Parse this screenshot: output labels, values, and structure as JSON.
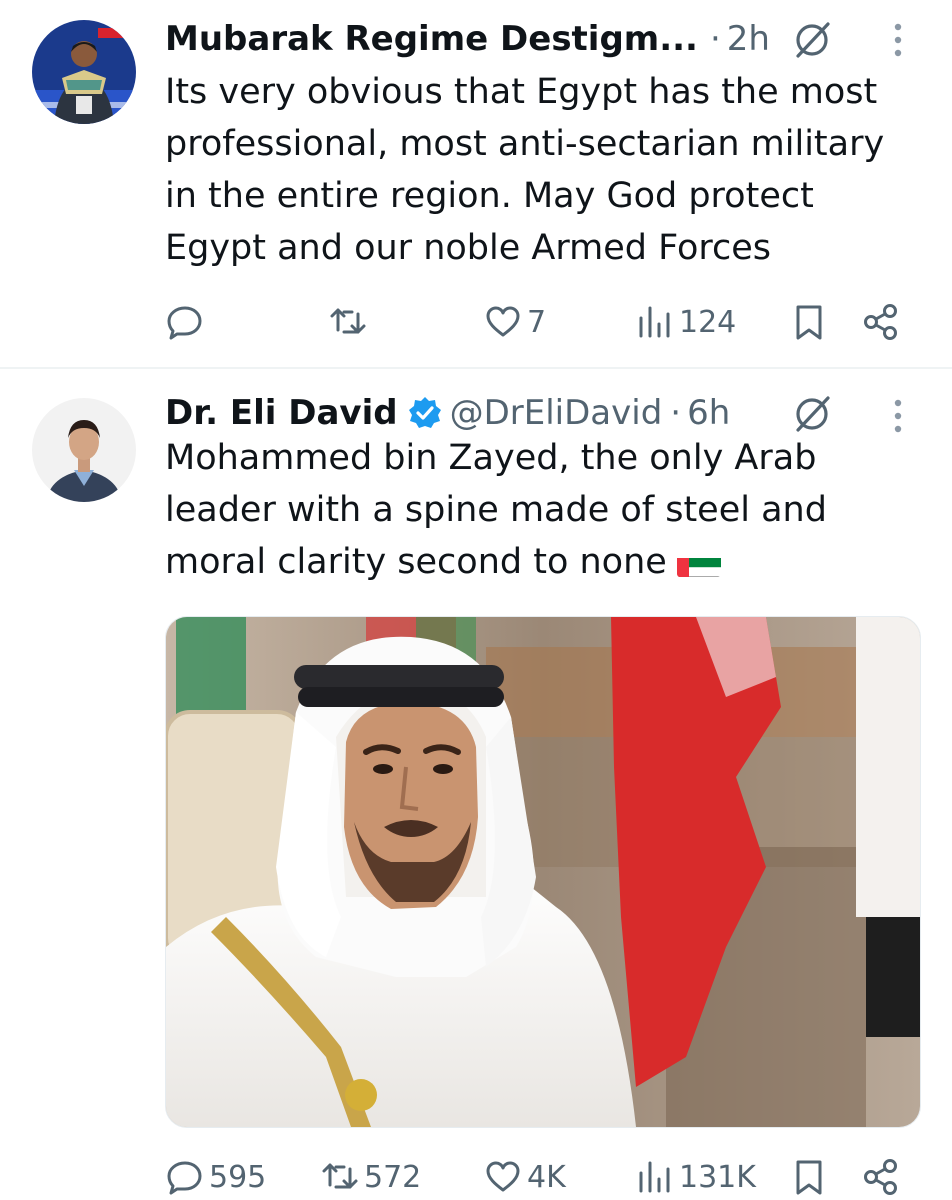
{
  "tweets": [
    {
      "display_name": "Mubarak Regime Destigm...",
      "separator": "·",
      "time": "2h",
      "text": "Its very obvious that Egypt has the most professional, most anti-sectarian military in the entire region. May God protect Egypt and our noble Armed Forces",
      "metrics": {
        "replies": "",
        "reposts": "",
        "likes": "7",
        "views": "124"
      }
    },
    {
      "display_name": "Dr. Eli David",
      "handle": "@DrEliDavid",
      "separator": "·",
      "time": "6h",
      "text": "Mohammed bin Zayed, the only Arab leader with a spine made of steel and moral clarity second to none",
      "emoji": "uae-flag",
      "metrics": {
        "replies": "595",
        "reposts": "572",
        "likes": "4K",
        "views": "131K"
      }
    }
  ],
  "icons": [
    "reply-icon",
    "repost-icon",
    "like-icon",
    "views-icon",
    "bookmark-icon",
    "share-icon",
    "grok-icon",
    "more-icon",
    "verified-badge-icon"
  ],
  "colors": {
    "text": "#0f1419",
    "muted": "#536471",
    "verified": "#1d9bf0",
    "divider": "#eff3f4"
  }
}
